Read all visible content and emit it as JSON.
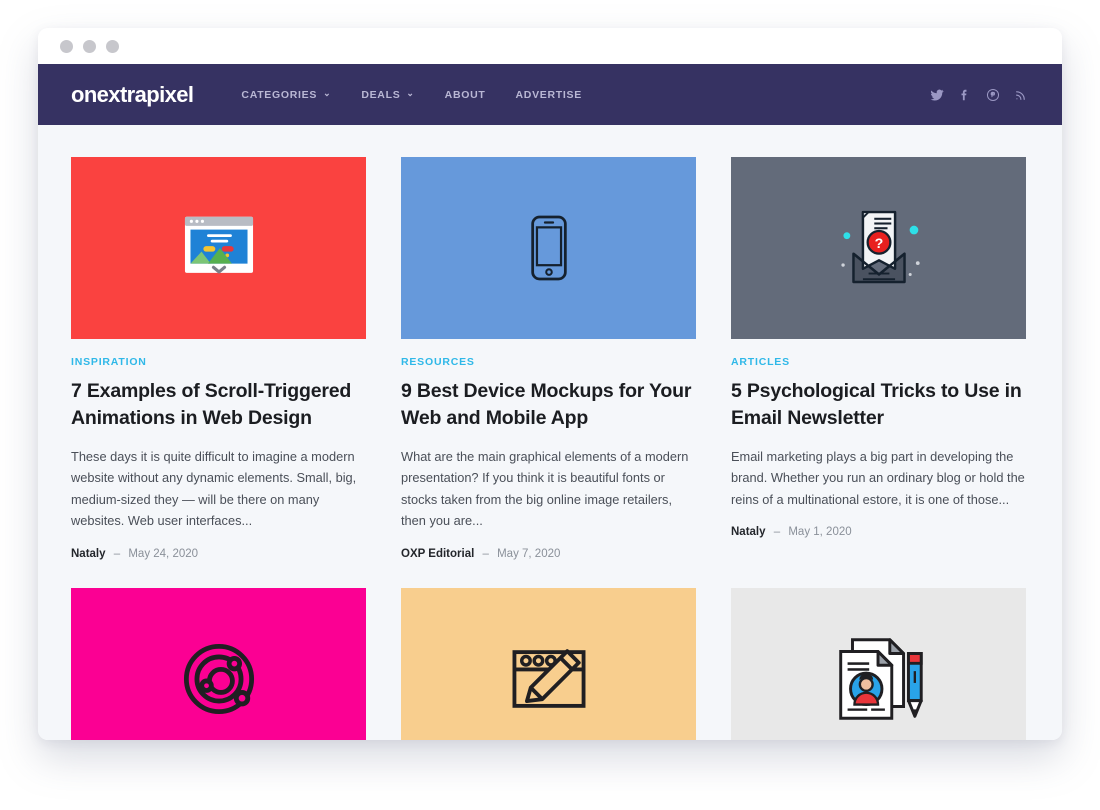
{
  "window": {
    "traffic_lights": [
      "close",
      "minimize",
      "maximize"
    ]
  },
  "header": {
    "logo": "onextrapixel",
    "nav": [
      {
        "label": "CATEGORIES",
        "has_dropdown": true,
        "caret": "⌄"
      },
      {
        "label": "DEALS",
        "has_dropdown": true,
        "caret": "⌄"
      },
      {
        "label": "ABOUT",
        "has_dropdown": false
      },
      {
        "label": "ADVERTISE",
        "has_dropdown": false
      }
    ],
    "social": [
      {
        "name": "twitter-icon"
      },
      {
        "name": "facebook-icon"
      },
      {
        "name": "pinterest-icon"
      },
      {
        "name": "rss-icon"
      }
    ],
    "colors": {
      "background": "#363262",
      "logo_text": "#ffffff",
      "nav_text": "#b9b7d4"
    }
  },
  "colors": {
    "page_background": "#f5f7fa",
    "category_accent": "#2fb8e8",
    "title_text": "#1b1d21",
    "excerpt_text": "#4a4f58",
    "meta_text": "#8a9099"
  },
  "posts": [
    {
      "thumb_color": "#fa4240",
      "thumb_icon": "browser-window-image-icon",
      "category": "INSPIRATION",
      "title": "7 Examples of Scroll-Triggered Animations in Web Design",
      "excerpt": "These days it is quite difficult to imagine a modern website without any dynamic elements. Small, big, medium-sized they — will be there on many websites. Web user interfaces...",
      "author": "Nataly",
      "separator": "–",
      "date": "May 24, 2020"
    },
    {
      "thumb_color": "#6699db",
      "thumb_icon": "smartphone-icon",
      "category": "RESOURCES",
      "title": "9 Best Device Mockups for Your Web and Mobile App",
      "excerpt": "What are the main graphical elements of a modern presentation? If you think it is beautiful fonts or stocks taken from the big online image retailers, then you are...",
      "author": "OXP Editorial",
      "separator": "–",
      "date": "May 7, 2020"
    },
    {
      "thumb_color": "#636b7a",
      "thumb_icon": "open-envelope-question-icon",
      "category": "ARTICLES",
      "title": "5 Psychological Tricks to Use in Email Newsletter",
      "excerpt": "Email marketing plays a big part in developing the brand. Whether you run an ordinary blog or hold the reins of a multinational estore, it is one of those...",
      "author": "Nataly",
      "separator": "–",
      "date": "May 1, 2020"
    }
  ],
  "posts_row2": [
    {
      "thumb_color": "#fb0093",
      "thumb_icon": "orbit-atom-icon"
    },
    {
      "thumb_color": "#f8ce8e",
      "thumb_icon": "browser-pencil-edit-icon"
    },
    {
      "thumb_color": "#e8e8e8",
      "thumb_icon": "documents-user-pencil-icon"
    }
  ]
}
